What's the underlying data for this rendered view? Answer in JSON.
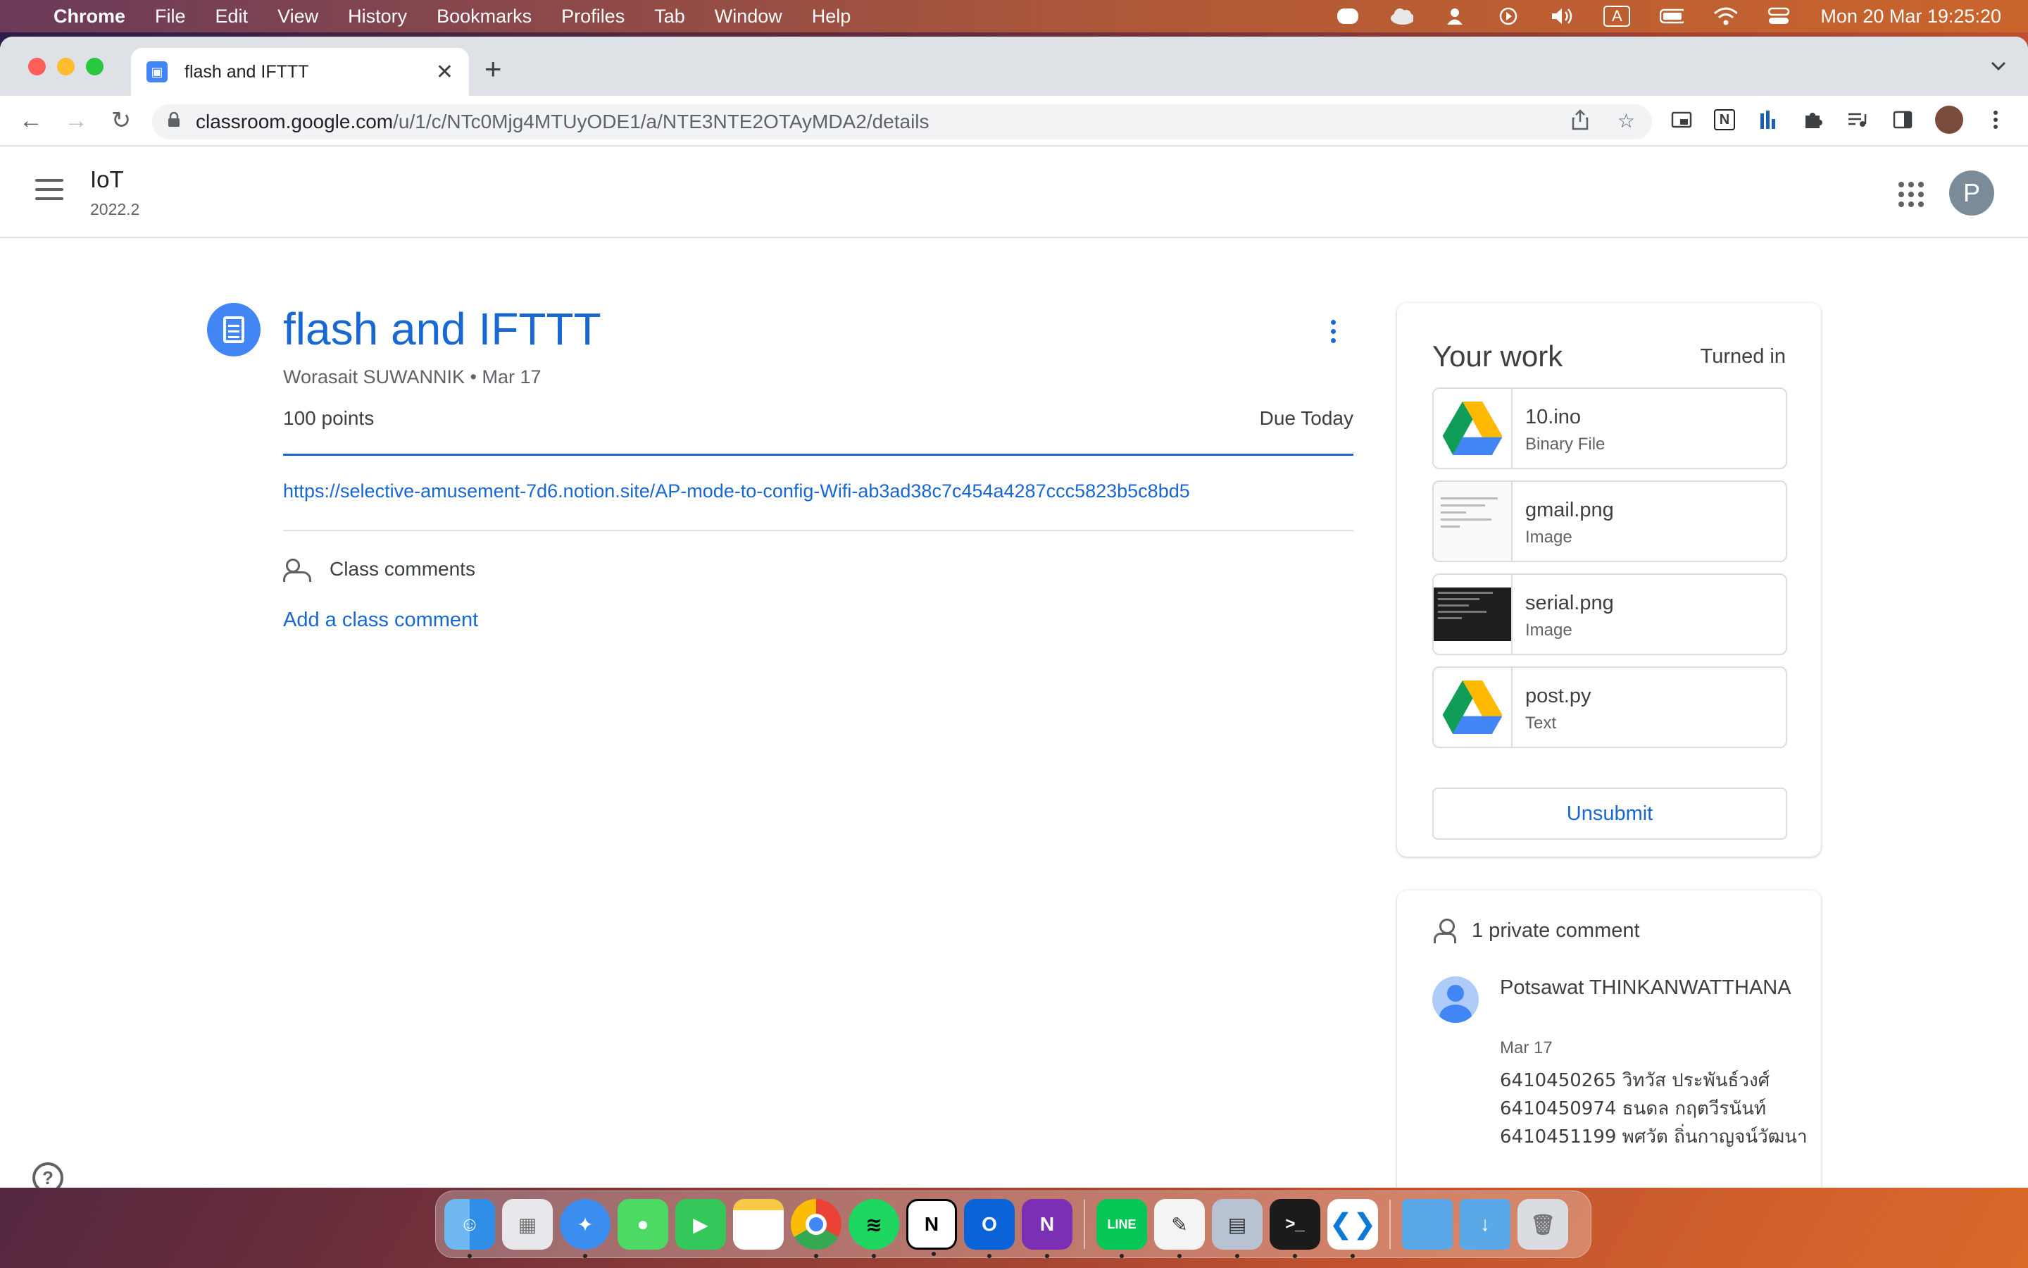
{
  "menubar": {
    "app": "Chrome",
    "items": [
      "File",
      "Edit",
      "View",
      "History",
      "Bookmarks",
      "Profiles",
      "Tab",
      "Window",
      "Help"
    ],
    "status_icons": [
      "line-icon",
      "cloud-icon",
      "user-icon",
      "play-icon",
      "volume-icon",
      "input-source-icon",
      "battery-icon",
      "wifi-icon",
      "control-center-icon"
    ],
    "input_source": "A",
    "datetime": "Mon 20 Mar  19:25:20"
  },
  "browser": {
    "tab_title": "flash and IFTTT",
    "url_host": "classroom.google.com",
    "url_path": "/u/1/c/NTc0Mjg4MTUyODE1/a/NTE3NTE2OTAyMDA2/details"
  },
  "classroom": {
    "course_name": "IoT",
    "course_section": "2022.2",
    "user_initial": "P"
  },
  "assignment": {
    "title": "flash and IFTTT",
    "meta": "Worasait SUWANNIK • Mar 17",
    "points": "100 points",
    "due": "Due Today",
    "link": "https://selective-amusement-7d6.notion.site/AP-mode-to-config-Wifi-ab3ad38c7c454a4287ccc5823b5c8bd5",
    "class_comments_label": "Class comments",
    "add_comment_label": "Add a class comment"
  },
  "your_work": {
    "title": "Your work",
    "status": "Turned in",
    "files": [
      {
        "name": "10.ino",
        "type": "Binary File",
        "thumb": "drive-icon"
      },
      {
        "name": "gmail.png",
        "type": "Image",
        "thumb": "screenshot-light"
      },
      {
        "name": "serial.png",
        "type": "Image",
        "thumb": "screenshot-dark"
      },
      {
        "name": "post.py",
        "type": "Text",
        "thumb": "drive-icon"
      }
    ],
    "unsubmit_label": "Unsubmit"
  },
  "private_comments": {
    "header": "1 private comment",
    "author": "Potsawat THINKANWATTHANA",
    "date": "Mar 17",
    "text": "6410450265  วิทวัส ประพันธ์วงศ์\n6410450974  ธนดล กฤตวีรนันท์\n6410451199  พศวัต ถิ่นกาญจน์วัฒนา"
  },
  "colors": {
    "accent": "#1967d2",
    "blue_icon": "#4285f4"
  }
}
